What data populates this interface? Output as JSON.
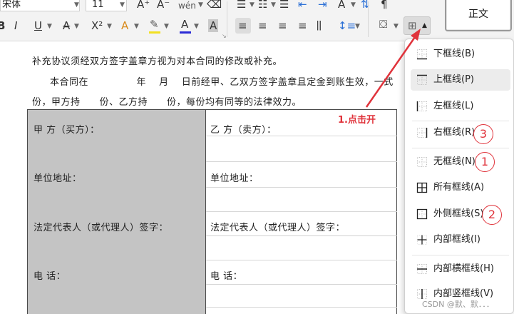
{
  "ribbon": {
    "font_name": "宋体",
    "font_size": "11",
    "grow_font": "A⁺",
    "shrink_font": "A⁻",
    "phonetic": "wén",
    "bold": "B",
    "italic": "I",
    "underline": "U",
    "strike": "A",
    "superscript": "X²",
    "text_effect": "A",
    "highlight": "✎",
    "font_color": "A",
    "char_shade": "A",
    "style_normal": "正文",
    "colors": {
      "highlight_bar": "#f2e021",
      "font_color_bar": "#2b2bd6",
      "accent": "#e0333b"
    }
  },
  "document": {
    "line1": "补充协议须经双方签字盖章方视为对本合同的修改或补充。",
    "line2": "本合同在　　　　　年　 月　 日前经甲、乙双方签字盖章且定金到账生效，一式",
    "line3": "份，甲方持　　份、乙方持　　份，每份均有同等的法律效力。"
  },
  "table": {
    "left": [
      "甲 方（买方）：",
      "单位地址：",
      "法定代表人（或代理人）签字：",
      "电 话："
    ],
    "right": [
      "乙 方（卖方）：",
      "单位地址：",
      "法定代表人（或代理人）签字：",
      "电 话："
    ]
  },
  "border_menu": {
    "items": [
      {
        "label": "下框线(B)",
        "icon": "bottom-border-icon"
      },
      {
        "label": "上框线(P)",
        "icon": "top-border-icon"
      },
      {
        "label": "左框线(L)",
        "icon": "left-border-icon"
      },
      {
        "label": "右框线(R)",
        "icon": "right-border-icon"
      },
      {
        "label": "无框线(N)",
        "icon": "no-border-icon"
      },
      {
        "label": "所有框线(A)",
        "icon": "all-borders-icon"
      },
      {
        "label": "外侧框线(S)",
        "icon": "outside-borders-icon"
      },
      {
        "label": "内部框线(I)",
        "icon": "inside-borders-icon"
      },
      {
        "label": "内部横框线(H)",
        "icon": "inside-horizontal-border-icon"
      },
      {
        "label": "内部竖框线(V)",
        "icon": "inside-vertical-border-icon"
      }
    ]
  },
  "annotations": {
    "click_open": "1.点击开",
    "num1": "1",
    "num2": "2",
    "num3": "3"
  },
  "watermark": "CSDN @默、默．．．"
}
